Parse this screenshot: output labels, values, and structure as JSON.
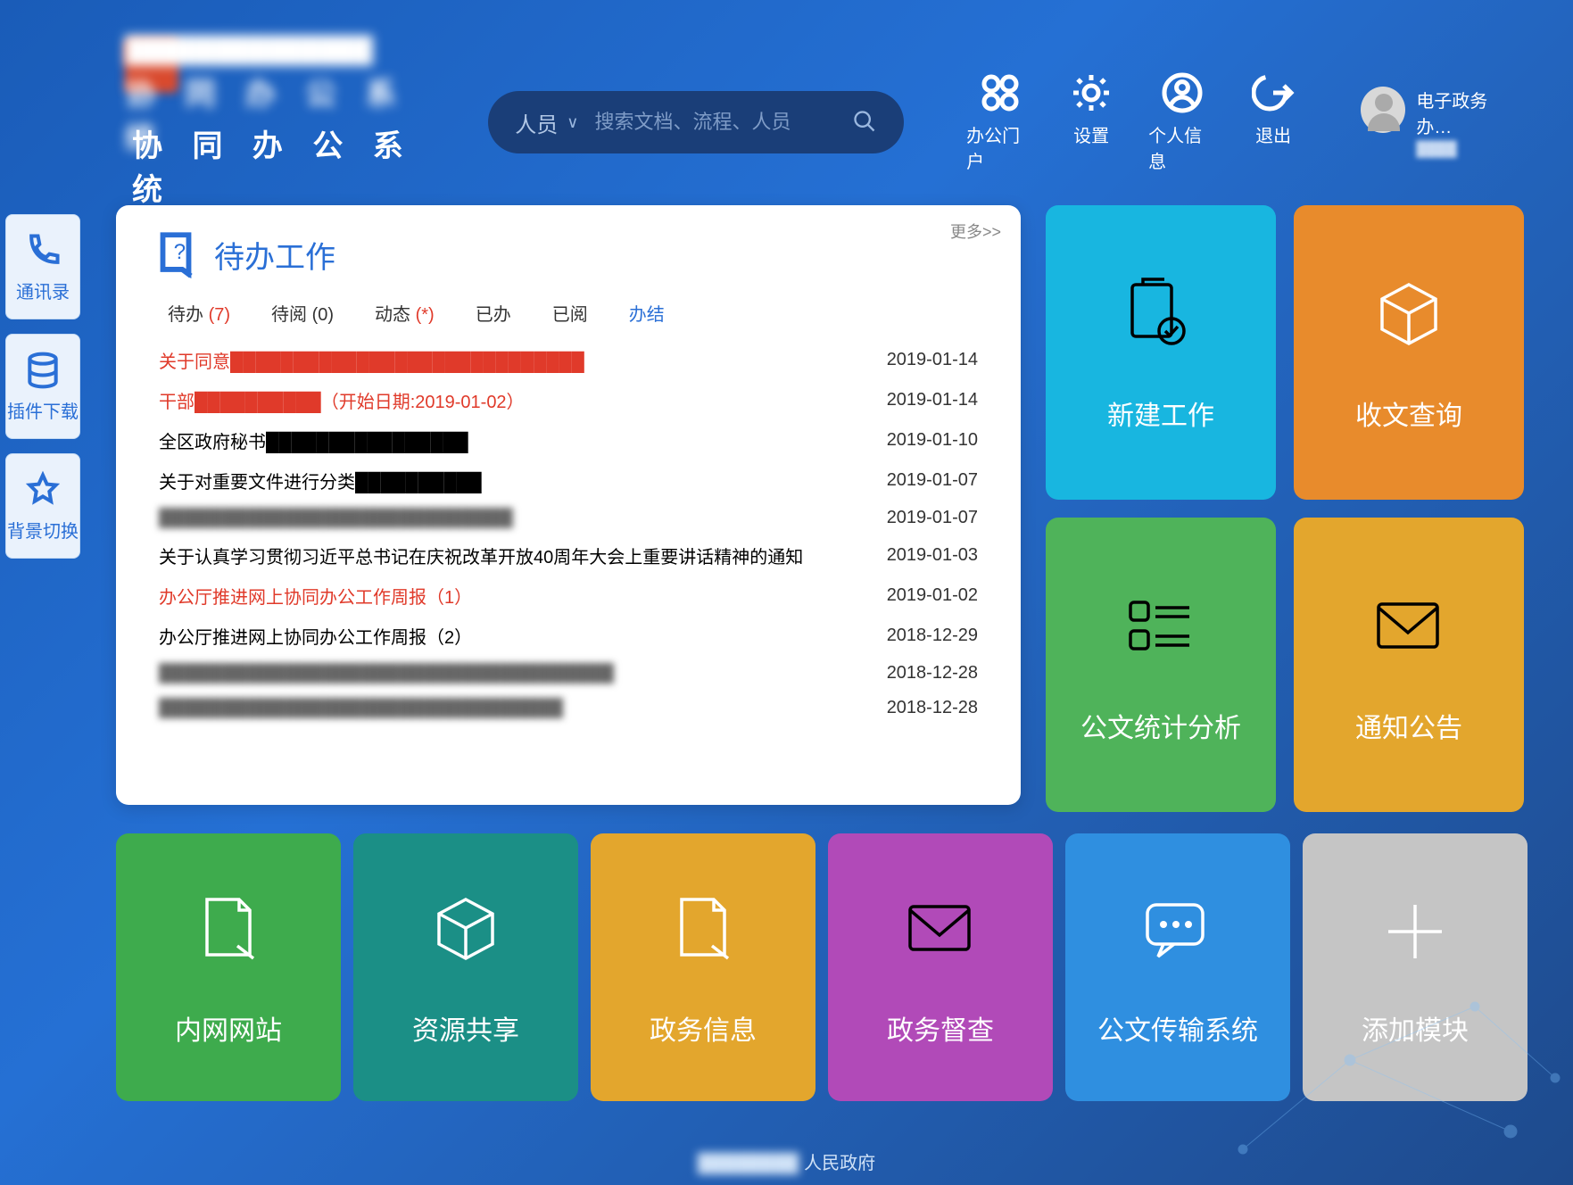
{
  "header": {
    "logo_line1": "██████████████",
    "logo_line2": "协 同 办 公 系 统",
    "search_scope": "人员",
    "search_placeholder": "搜索文档、流程、人员",
    "actions": [
      {
        "label": "办公门户"
      },
      {
        "label": "设置"
      },
      {
        "label": "个人信息"
      },
      {
        "label": "退出"
      }
    ],
    "user_name": "电子政务办…",
    "user_sub": "████"
  },
  "dock": [
    {
      "label": "通讯录"
    },
    {
      "label": "插件下载"
    },
    {
      "label": "背景切换"
    }
  ],
  "panel": {
    "title": "待办工作",
    "more": "更多>>",
    "tabs": [
      {
        "label": "待办",
        "count": "(7)",
        "count_style": "red"
      },
      {
        "label": "待阅",
        "count": "(0)"
      },
      {
        "label": "动态",
        "count": "(*)",
        "count_style": "red"
      },
      {
        "label": "已办",
        "count": ""
      },
      {
        "label": "已阅",
        "count": ""
      },
      {
        "label": "办结",
        "count": "",
        "active": true
      }
    ],
    "rows": [
      {
        "title": "关于同意████████████████████████████",
        "date": "2019-01-14",
        "style": "red"
      },
      {
        "title": "干部██████████（开始日期:2019-01-02）",
        "date": "2019-01-14",
        "style": "red"
      },
      {
        "title": "全区政府秘书████████████████",
        "date": "2019-01-10",
        "style": "normal"
      },
      {
        "title": "关于对重要文件进行分类██████████",
        "date": "2019-01-07",
        "style": "normal"
      },
      {
        "title": "████████████████████████████",
        "date": "2019-01-07",
        "style": "blur"
      },
      {
        "title": "关于认真学习贯彻习近平总书记在庆祝改革开放40周年大会上重要讲话精神的通知",
        "date": "2019-01-03",
        "style": "normal"
      },
      {
        "title": "办公厅推进网上协同办公工作周报（1）",
        "date": "2019-01-02",
        "style": "red"
      },
      {
        "title": "办公厅推进网上协同办公工作周报（2）",
        "date": "2018-12-29",
        "style": "normal"
      },
      {
        "title": "████████████████████████████████████",
        "date": "2018-12-28",
        "style": "blur"
      },
      {
        "title": "████████████████████████████████",
        "date": "2018-12-28",
        "style": "blur"
      }
    ]
  },
  "tiles_right": [
    {
      "label": "新建工作",
      "color": "c-cyan",
      "icon": "doc-check"
    },
    {
      "label": "收文查询",
      "color": "c-orange",
      "icon": "cube",
      "white": true
    },
    {
      "label": "公文统计分析",
      "color": "c-green",
      "icon": "list"
    },
    {
      "label": "通知公告",
      "color": "c-amber",
      "icon": "mail"
    }
  ],
  "tiles_bottom": [
    {
      "label": "内网网站",
      "color": "c-green2",
      "icon": "doc-edit",
      "white": true
    },
    {
      "label": "资源共享",
      "color": "c-teal",
      "icon": "cube",
      "white": true
    },
    {
      "label": "政务信息",
      "color": "c-yellow",
      "icon": "doc-edit",
      "white": true
    },
    {
      "label": "政务督查",
      "color": "c-purple",
      "icon": "mail"
    },
    {
      "label": "公文传输系统",
      "color": "c-blue",
      "icon": "chat",
      "white": true
    },
    {
      "label": "添加模块",
      "color": "c-gray",
      "icon": "plus",
      "white": true
    }
  ],
  "footer": {
    "blur": "████████",
    "text": "人民政府"
  }
}
